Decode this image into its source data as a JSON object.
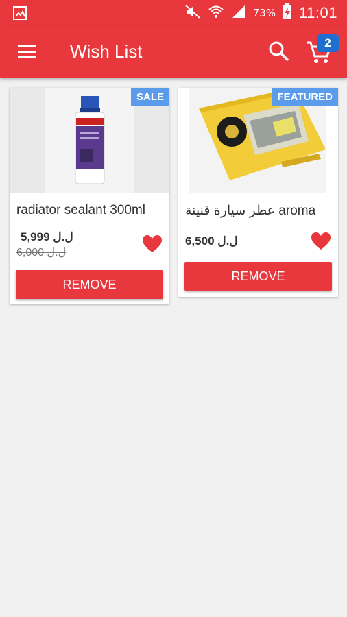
{
  "status_bar": {
    "battery": "73%",
    "time": "11:01"
  },
  "app_bar": {
    "title": "Wish List",
    "cart_count": "2"
  },
  "colors": {
    "primary": "#e8383d",
    "badge": "#1e6fd0",
    "tag": "#5b9bec"
  },
  "products": [
    {
      "name": "radiator sealant 300ml",
      "badge": "SALE",
      "price": "ل.ل 5,999",
      "old_price": "ل.ل 6,000",
      "remove_label": "REMOVE",
      "favorite": true
    },
    {
      "name": "عطر سيارة قنينة aroma",
      "badge": "FEATURED",
      "price": "ل.ل 6,500",
      "old_price": "",
      "remove_label": "REMOVE",
      "favorite": true
    }
  ]
}
